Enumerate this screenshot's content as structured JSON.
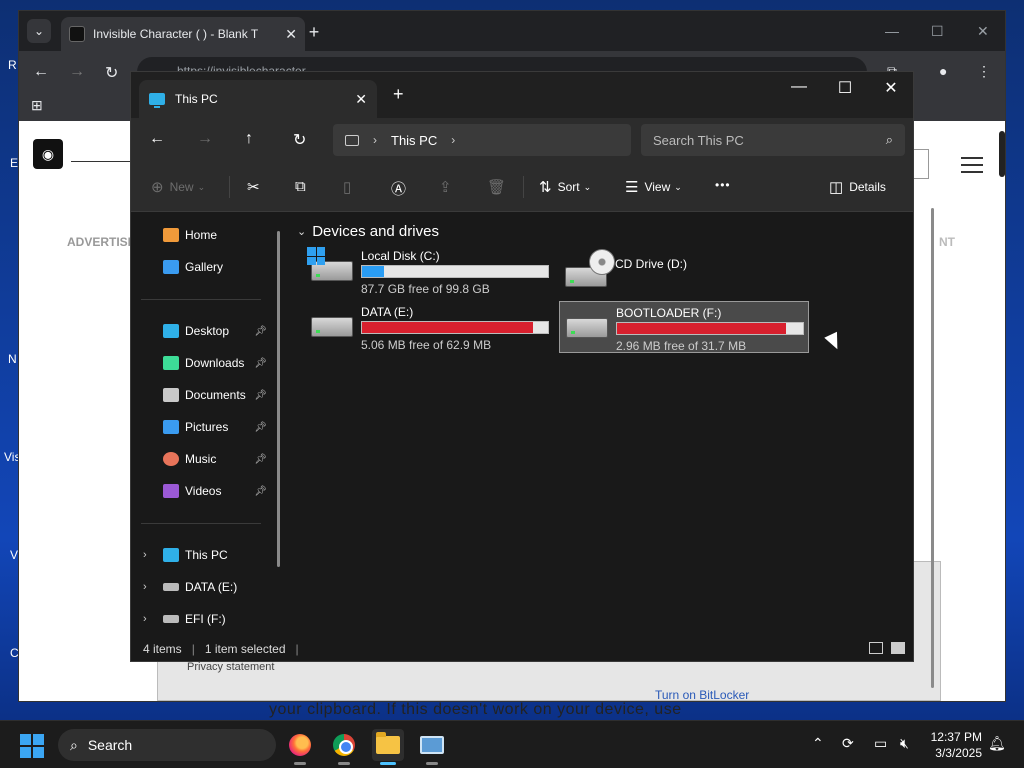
{
  "desktop": {
    "letters": [
      "R",
      "E",
      "N",
      "Vis",
      "V",
      "C"
    ]
  },
  "browser": {
    "tab_title": "Invisible Character (     ) - Blank T",
    "address_text": "https://invisiblecharacter...",
    "advertisement_label": "ADVERTISE",
    "advertisement_label_right": "NT",
    "privacy": "Privacy statement",
    "bitlocker_link": "Turn on BitLocker",
    "bottom_text": "your clipboard. If this doesn't work on your device, use"
  },
  "explorer": {
    "tab_title": "This PC",
    "address": {
      "location": "This PC"
    },
    "search_placeholder": "Search This PC",
    "commands": {
      "new": "New",
      "sort": "Sort",
      "view": "View",
      "more": "•••",
      "details": "Details"
    },
    "nav": {
      "home": "Home",
      "gallery": "Gallery",
      "quick_access": [
        {
          "label": "Desktop",
          "icon": "desktop-icon",
          "color": "#2fb0e8"
        },
        {
          "label": "Downloads",
          "icon": "downloads-icon",
          "color": "#3ddc97"
        },
        {
          "label": "Documents",
          "icon": "documents-icon",
          "color": "#c9c9c9"
        },
        {
          "label": "Pictures",
          "icon": "pictures-icon",
          "color": "#3a9bf0"
        },
        {
          "label": "Music",
          "icon": "music-icon",
          "color": "#e8745a"
        },
        {
          "label": "Videos",
          "icon": "videos-icon",
          "color": "#9b59d6"
        }
      ],
      "this_pc": "This PC",
      "data_drive": "DATA (E:)",
      "efi_drive": "EFI (F:)"
    },
    "group_title": "Devices and drives",
    "drives": [
      {
        "name": "Local Disk (C:)",
        "free": "87.7 GB free of 99.8 GB",
        "used_fraction": 0.12,
        "bar_color": "#2a9df4",
        "icon": "windows-drive-icon"
      },
      {
        "name": "CD Drive (D:)",
        "free": "",
        "used_fraction": 0,
        "bar_color": "",
        "icon": "cd-drive-icon"
      },
      {
        "name": "DATA (E:)",
        "free": "5.06 MB free of 62.9 MB",
        "used_fraction": 0.92,
        "bar_color": "#d8202e",
        "icon": "drive-icon"
      },
      {
        "name": "BOOTLOADER (F:)",
        "free": "2.96 MB free of 31.7 MB",
        "used_fraction": 0.91,
        "bar_color": "#d8202e",
        "icon": "drive-icon"
      }
    ],
    "status": {
      "items": "4 items",
      "selected": "1 item selected"
    }
  },
  "taskbar": {
    "search": "Search",
    "time": "12:37 PM",
    "date": "3/3/2025"
  }
}
